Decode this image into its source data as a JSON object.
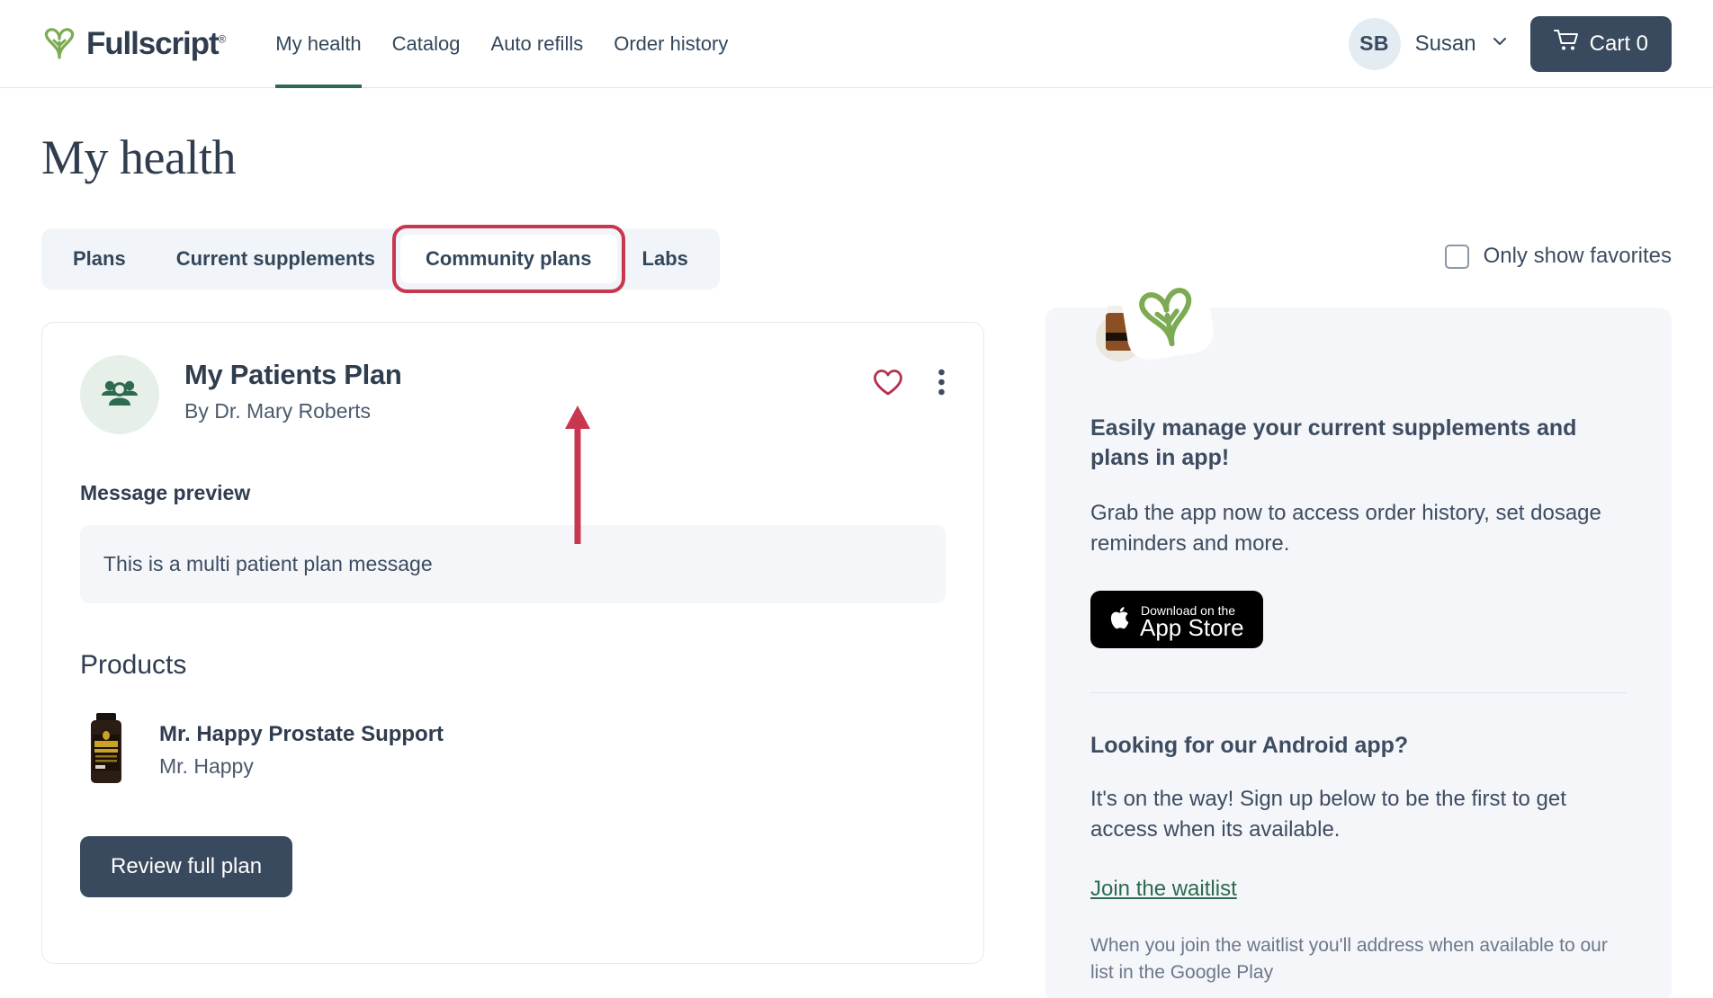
{
  "brand": {
    "name": "Fullscript",
    "trademark": "®",
    "logo_icon": "fullscript-leaf-logo",
    "green": "#7cab53",
    "accent_green": "#2d6a4f",
    "dark": "#3a4a5e",
    "annotation_red": "#c9364f"
  },
  "nav": {
    "links": [
      {
        "label": "My health",
        "active": true
      },
      {
        "label": "Catalog",
        "active": false
      },
      {
        "label": "Auto refills",
        "active": false
      },
      {
        "label": "Order history",
        "active": false
      }
    ],
    "user": {
      "initials": "SB",
      "name": "Susan",
      "chevron_icon": "chevron-down-icon"
    },
    "cart": {
      "label": "Cart 0",
      "icon": "shopping-cart-icon",
      "count": 0
    }
  },
  "page": {
    "title": "My health"
  },
  "tabs": {
    "items": [
      {
        "label": "Plans",
        "selected": false
      },
      {
        "label": "Current supplements",
        "selected": false
      },
      {
        "label": "Community plans",
        "selected": true
      },
      {
        "label": "Labs",
        "selected": false
      }
    ]
  },
  "favorites": {
    "label": "Only show favorites",
    "checked": false
  },
  "plan_card": {
    "avatar_icon": "group-of-people-icon",
    "title": "My Patients Plan",
    "author": "By Dr. Mary Roberts",
    "favorite_icon": "heart-outline-icon",
    "menu_icon": "vertical-dots-menu-icon",
    "message_label": "Message preview",
    "message_text": "This is a multi patient plan message",
    "products_label": "Products",
    "products": [
      {
        "name": "Mr. Happy Prostate Support",
        "brand": "Mr. Happy",
        "thumb_icon": "supplement-bottle-thumbnail",
        "label_text": "Mr HAPPY"
      }
    ],
    "review_button": "Review full plan"
  },
  "promo": {
    "icon": "fullscript-app-icon",
    "heading": "Easily manage your current supplements and plans in app!",
    "body": "Grab the app now to access order history, set dosage reminders and more.",
    "appstore_badge": {
      "small_text": "Download on the",
      "large_text": "App Store",
      "icon": "apple-logo-icon"
    },
    "android_heading": "Looking for our Android app?",
    "android_body": "It's on the way! Sign up below to be the first to get access when its available.",
    "waitlist_link": "Join the waitlist",
    "footnote": "When you join the waitlist you'll address when available to our list in the Google Play"
  }
}
